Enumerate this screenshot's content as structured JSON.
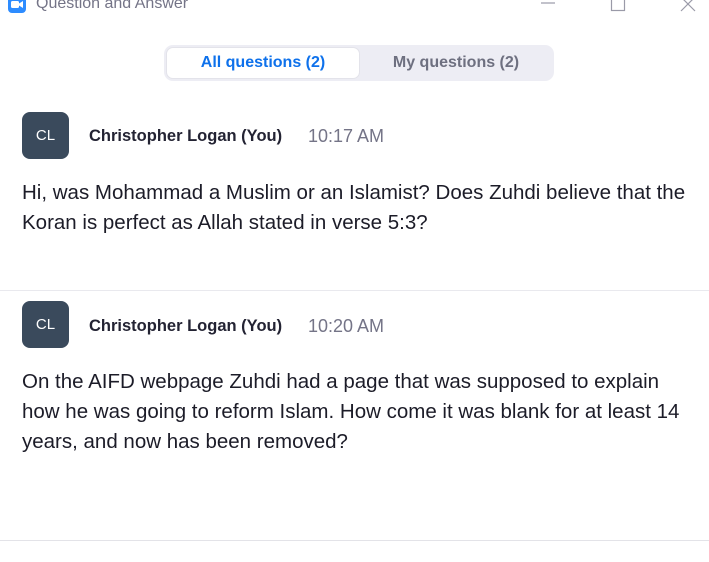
{
  "window": {
    "title": "Question and Answer"
  },
  "tabs": [
    {
      "label": "All questions (2)",
      "active": true
    },
    {
      "label": "My questions (2)",
      "active": false
    }
  ],
  "questions": [
    {
      "initials": "CL",
      "author": "Christopher Logan (You)",
      "time": "10:17 AM",
      "text": "Hi, was Mohammad a Muslim or an Islamist? Does Zuhdi believe that the Koran is perfect as Allah stated in verse 5:3?"
    },
    {
      "initials": "CL",
      "author": "Christopher Logan (You)",
      "time": "10:20 AM",
      "text": "On the AIFD webpage Zuhdi had a page that was supposed to explain how he was going to reform Islam. How come it was blank for at least 14 years, and now has been removed?"
    }
  ],
  "colors": {
    "accent": "#0e71eb",
    "avatar_bg": "#3a4a5c",
    "tab_track": "#ededf4"
  }
}
